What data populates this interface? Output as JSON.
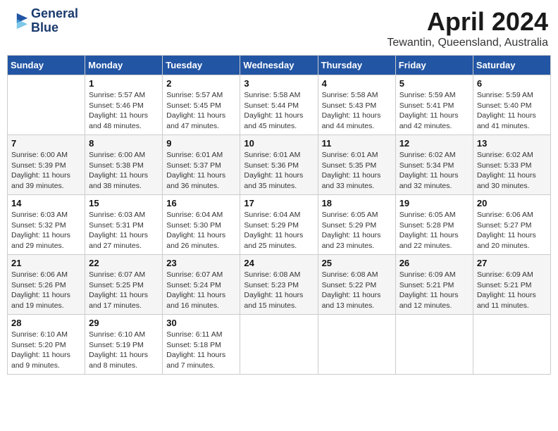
{
  "logo": {
    "line1": "General",
    "line2": "Blue"
  },
  "title": "April 2024",
  "location": "Tewantin, Queensland, Australia",
  "weekdays": [
    "Sunday",
    "Monday",
    "Tuesday",
    "Wednesday",
    "Thursday",
    "Friday",
    "Saturday"
  ],
  "weeks": [
    [
      {
        "day": "",
        "info": ""
      },
      {
        "day": "1",
        "info": "Sunrise: 5:57 AM\nSunset: 5:46 PM\nDaylight: 11 hours\nand 48 minutes."
      },
      {
        "day": "2",
        "info": "Sunrise: 5:57 AM\nSunset: 5:45 PM\nDaylight: 11 hours\nand 47 minutes."
      },
      {
        "day": "3",
        "info": "Sunrise: 5:58 AM\nSunset: 5:44 PM\nDaylight: 11 hours\nand 45 minutes."
      },
      {
        "day": "4",
        "info": "Sunrise: 5:58 AM\nSunset: 5:43 PM\nDaylight: 11 hours\nand 44 minutes."
      },
      {
        "day": "5",
        "info": "Sunrise: 5:59 AM\nSunset: 5:41 PM\nDaylight: 11 hours\nand 42 minutes."
      },
      {
        "day": "6",
        "info": "Sunrise: 5:59 AM\nSunset: 5:40 PM\nDaylight: 11 hours\nand 41 minutes."
      }
    ],
    [
      {
        "day": "7",
        "info": "Sunrise: 6:00 AM\nSunset: 5:39 PM\nDaylight: 11 hours\nand 39 minutes."
      },
      {
        "day": "8",
        "info": "Sunrise: 6:00 AM\nSunset: 5:38 PM\nDaylight: 11 hours\nand 38 minutes."
      },
      {
        "day": "9",
        "info": "Sunrise: 6:01 AM\nSunset: 5:37 PM\nDaylight: 11 hours\nand 36 minutes."
      },
      {
        "day": "10",
        "info": "Sunrise: 6:01 AM\nSunset: 5:36 PM\nDaylight: 11 hours\nand 35 minutes."
      },
      {
        "day": "11",
        "info": "Sunrise: 6:01 AM\nSunset: 5:35 PM\nDaylight: 11 hours\nand 33 minutes."
      },
      {
        "day": "12",
        "info": "Sunrise: 6:02 AM\nSunset: 5:34 PM\nDaylight: 11 hours\nand 32 minutes."
      },
      {
        "day": "13",
        "info": "Sunrise: 6:02 AM\nSunset: 5:33 PM\nDaylight: 11 hours\nand 30 minutes."
      }
    ],
    [
      {
        "day": "14",
        "info": "Sunrise: 6:03 AM\nSunset: 5:32 PM\nDaylight: 11 hours\nand 29 minutes."
      },
      {
        "day": "15",
        "info": "Sunrise: 6:03 AM\nSunset: 5:31 PM\nDaylight: 11 hours\nand 27 minutes."
      },
      {
        "day": "16",
        "info": "Sunrise: 6:04 AM\nSunset: 5:30 PM\nDaylight: 11 hours\nand 26 minutes."
      },
      {
        "day": "17",
        "info": "Sunrise: 6:04 AM\nSunset: 5:29 PM\nDaylight: 11 hours\nand 25 minutes."
      },
      {
        "day": "18",
        "info": "Sunrise: 6:05 AM\nSunset: 5:29 PM\nDaylight: 11 hours\nand 23 minutes."
      },
      {
        "day": "19",
        "info": "Sunrise: 6:05 AM\nSunset: 5:28 PM\nDaylight: 11 hours\nand 22 minutes."
      },
      {
        "day": "20",
        "info": "Sunrise: 6:06 AM\nSunset: 5:27 PM\nDaylight: 11 hours\nand 20 minutes."
      }
    ],
    [
      {
        "day": "21",
        "info": "Sunrise: 6:06 AM\nSunset: 5:26 PM\nDaylight: 11 hours\nand 19 minutes."
      },
      {
        "day": "22",
        "info": "Sunrise: 6:07 AM\nSunset: 5:25 PM\nDaylight: 11 hours\nand 17 minutes."
      },
      {
        "day": "23",
        "info": "Sunrise: 6:07 AM\nSunset: 5:24 PM\nDaylight: 11 hours\nand 16 minutes."
      },
      {
        "day": "24",
        "info": "Sunrise: 6:08 AM\nSunset: 5:23 PM\nDaylight: 11 hours\nand 15 minutes."
      },
      {
        "day": "25",
        "info": "Sunrise: 6:08 AM\nSunset: 5:22 PM\nDaylight: 11 hours\nand 13 minutes."
      },
      {
        "day": "26",
        "info": "Sunrise: 6:09 AM\nSunset: 5:21 PM\nDaylight: 11 hours\nand 12 minutes."
      },
      {
        "day": "27",
        "info": "Sunrise: 6:09 AM\nSunset: 5:21 PM\nDaylight: 11 hours\nand 11 minutes."
      }
    ],
    [
      {
        "day": "28",
        "info": "Sunrise: 6:10 AM\nSunset: 5:20 PM\nDaylight: 11 hours\nand 9 minutes."
      },
      {
        "day": "29",
        "info": "Sunrise: 6:10 AM\nSunset: 5:19 PM\nDaylight: 11 hours\nand 8 minutes."
      },
      {
        "day": "30",
        "info": "Sunrise: 6:11 AM\nSunset: 5:18 PM\nDaylight: 11 hours\nand 7 minutes."
      },
      {
        "day": "",
        "info": ""
      },
      {
        "day": "",
        "info": ""
      },
      {
        "day": "",
        "info": ""
      },
      {
        "day": "",
        "info": ""
      }
    ]
  ]
}
